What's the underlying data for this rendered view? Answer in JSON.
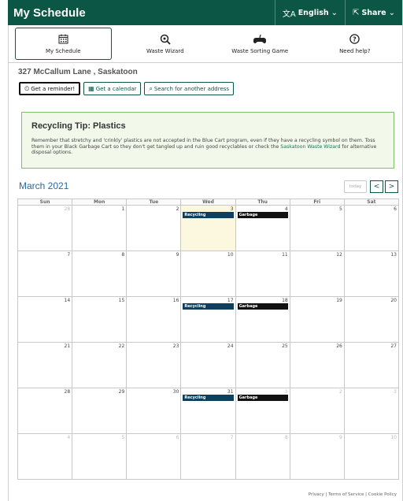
{
  "header": {
    "title": "My Schedule",
    "language_label": "English",
    "share_label": "Share"
  },
  "nav": {
    "tabs": [
      {
        "label": "My Schedule",
        "icon": "calendar-icon"
      },
      {
        "label": "Waste Wizard",
        "icon": "magnifier-icon"
      },
      {
        "label": "Waste Sorting Game",
        "icon": "gamepad-icon"
      },
      {
        "label": "Need help?",
        "icon": "help-icon"
      }
    ]
  },
  "address": "327 McCallum Lane , Saskatoon",
  "actions": {
    "reminder": "Get a reminder!",
    "calendar": "Get a calendar",
    "search": "Search for another address"
  },
  "tip": {
    "title": "Recycling Tip: Plastics",
    "body": "Remember that stretchy and 'crinkly' plastics are not accepted in the Blue Cart program, even if they have a recycling symbol on them. Toss them in your Black Garbage Cart so they don't get tangled up and ruin good recyclables or check the ",
    "link": "Saskatoon Waste Wizard",
    "body_end": " for alternative disposal options."
  },
  "calendar": {
    "month_title": "March 2021",
    "today_label": "today",
    "prev_label": "<",
    "next_label": ">",
    "days_of_week": [
      "Sun",
      "Mon",
      "Tue",
      "Wed",
      "Thu",
      "Fri",
      "Sat"
    ],
    "weeks": [
      [
        {
          "day": "28",
          "other": true
        },
        {
          "day": "1"
        },
        {
          "day": "2"
        },
        {
          "day": "3",
          "today": true,
          "event": "Recycling"
        },
        {
          "day": "4",
          "event": "Garbage"
        },
        {
          "day": "5"
        },
        {
          "day": "6"
        }
      ],
      [
        {
          "day": "7"
        },
        {
          "day": "8"
        },
        {
          "day": "9"
        },
        {
          "day": "10"
        },
        {
          "day": "11"
        },
        {
          "day": "12"
        },
        {
          "day": "13"
        }
      ],
      [
        {
          "day": "14"
        },
        {
          "day": "15"
        },
        {
          "day": "16"
        },
        {
          "day": "17",
          "event": "Recycling"
        },
        {
          "day": "18",
          "event": "Garbage"
        },
        {
          "day": "19"
        },
        {
          "day": "20"
        }
      ],
      [
        {
          "day": "21"
        },
        {
          "day": "22"
        },
        {
          "day": "23"
        },
        {
          "day": "24"
        },
        {
          "day": "25"
        },
        {
          "day": "26"
        },
        {
          "day": "27"
        }
      ],
      [
        {
          "day": "28"
        },
        {
          "day": "29"
        },
        {
          "day": "30"
        },
        {
          "day": "31",
          "event": "Recycling"
        },
        {
          "day": "1",
          "other": true,
          "event": "Garbage"
        },
        {
          "day": "2",
          "other": true
        },
        {
          "day": "3",
          "other": true
        }
      ],
      [
        {
          "day": "4",
          "other": true
        },
        {
          "day": "5",
          "other": true
        },
        {
          "day": "6",
          "other": true
        },
        {
          "day": "7",
          "other": true
        },
        {
          "day": "8",
          "other": true
        },
        {
          "day": "9",
          "other": true
        },
        {
          "day": "10",
          "other": true
        }
      ]
    ]
  },
  "footer": {
    "privacy": "Privacy",
    "terms": "Terms of Service",
    "cookie": "Cookie Policy",
    "separator": " | "
  },
  "colors": {
    "brand": "#0b5645",
    "recycling": "#0f3f5c",
    "garbage": "#111111",
    "today": "#fcf7df",
    "tip_bg": "#f2f8ea",
    "tip_border": "#7fbf6b"
  }
}
